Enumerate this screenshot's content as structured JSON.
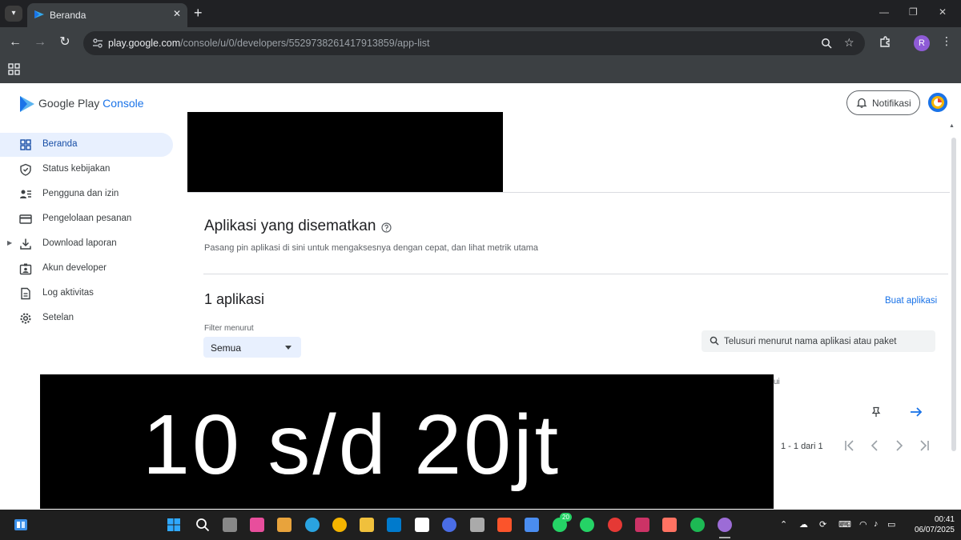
{
  "browser": {
    "tab_title": "Beranda",
    "url_host": "play.google.com",
    "url_path": "/console/u/0/developers/5529738261417913859/app-list",
    "profile_initial": "R"
  },
  "sidebar": {
    "brand_a": "Google Play",
    "brand_b": "Console",
    "items": [
      {
        "label": "Beranda",
        "icon": "grid-icon",
        "active": true
      },
      {
        "label": "Status kebijakan",
        "icon": "shield-icon"
      },
      {
        "label": "Pengguna dan izin",
        "icon": "users-list-icon"
      },
      {
        "label": "Pengelolaan pesanan",
        "icon": "credit-card-icon"
      },
      {
        "label": "Download laporan",
        "icon": "download-icon"
      },
      {
        "label": "Akun developer",
        "icon": "id-badge-icon"
      },
      {
        "label": "Log aktivitas",
        "icon": "document-icon"
      },
      {
        "label": "Setelan",
        "icon": "gear-icon"
      }
    ]
  },
  "header": {
    "notif_label": "Notifikasi"
  },
  "pinned": {
    "title": "Aplikasi yang disematkan",
    "desc": "Pasang pin aplikasi di sini untuk mengaksesnya dengan cepat, dan lihat metrik utama"
  },
  "apps": {
    "count_title": "1 aplikasi",
    "create_label": "Buat aplikasi",
    "filter_label": "Filter menurut",
    "filter_value": "Semua",
    "search_placeholder": "Telusuri menurut nama aplikasi atau paket",
    "column_fragment": "ui",
    "pager": "1 - 1 dari 1"
  },
  "overlay": {
    "text": "10 s/d 20jt"
  },
  "taskbar": {
    "time": "00:41",
    "date": "06/07/2025",
    "whatsapp_badge": "20",
    "colors": [
      "#0078d4",
      "#ffffff",
      "#888888",
      "#e84e9c",
      "#e8a33c",
      "#2aa3e0",
      "#f4b400",
      "#f0c03c",
      "#007acc",
      "#ffffff",
      "#4a6de5",
      "#aaaaaa",
      "#fb542b",
      "#4a8df0",
      "#25d366",
      "#25d366",
      "#e53935",
      "#cc3366",
      "#ff7262",
      "#1db954",
      "#9c6cd6"
    ]
  },
  "colors": {
    "accent": "#1a73e8",
    "active_nav_bg": "#e8f0fe"
  }
}
